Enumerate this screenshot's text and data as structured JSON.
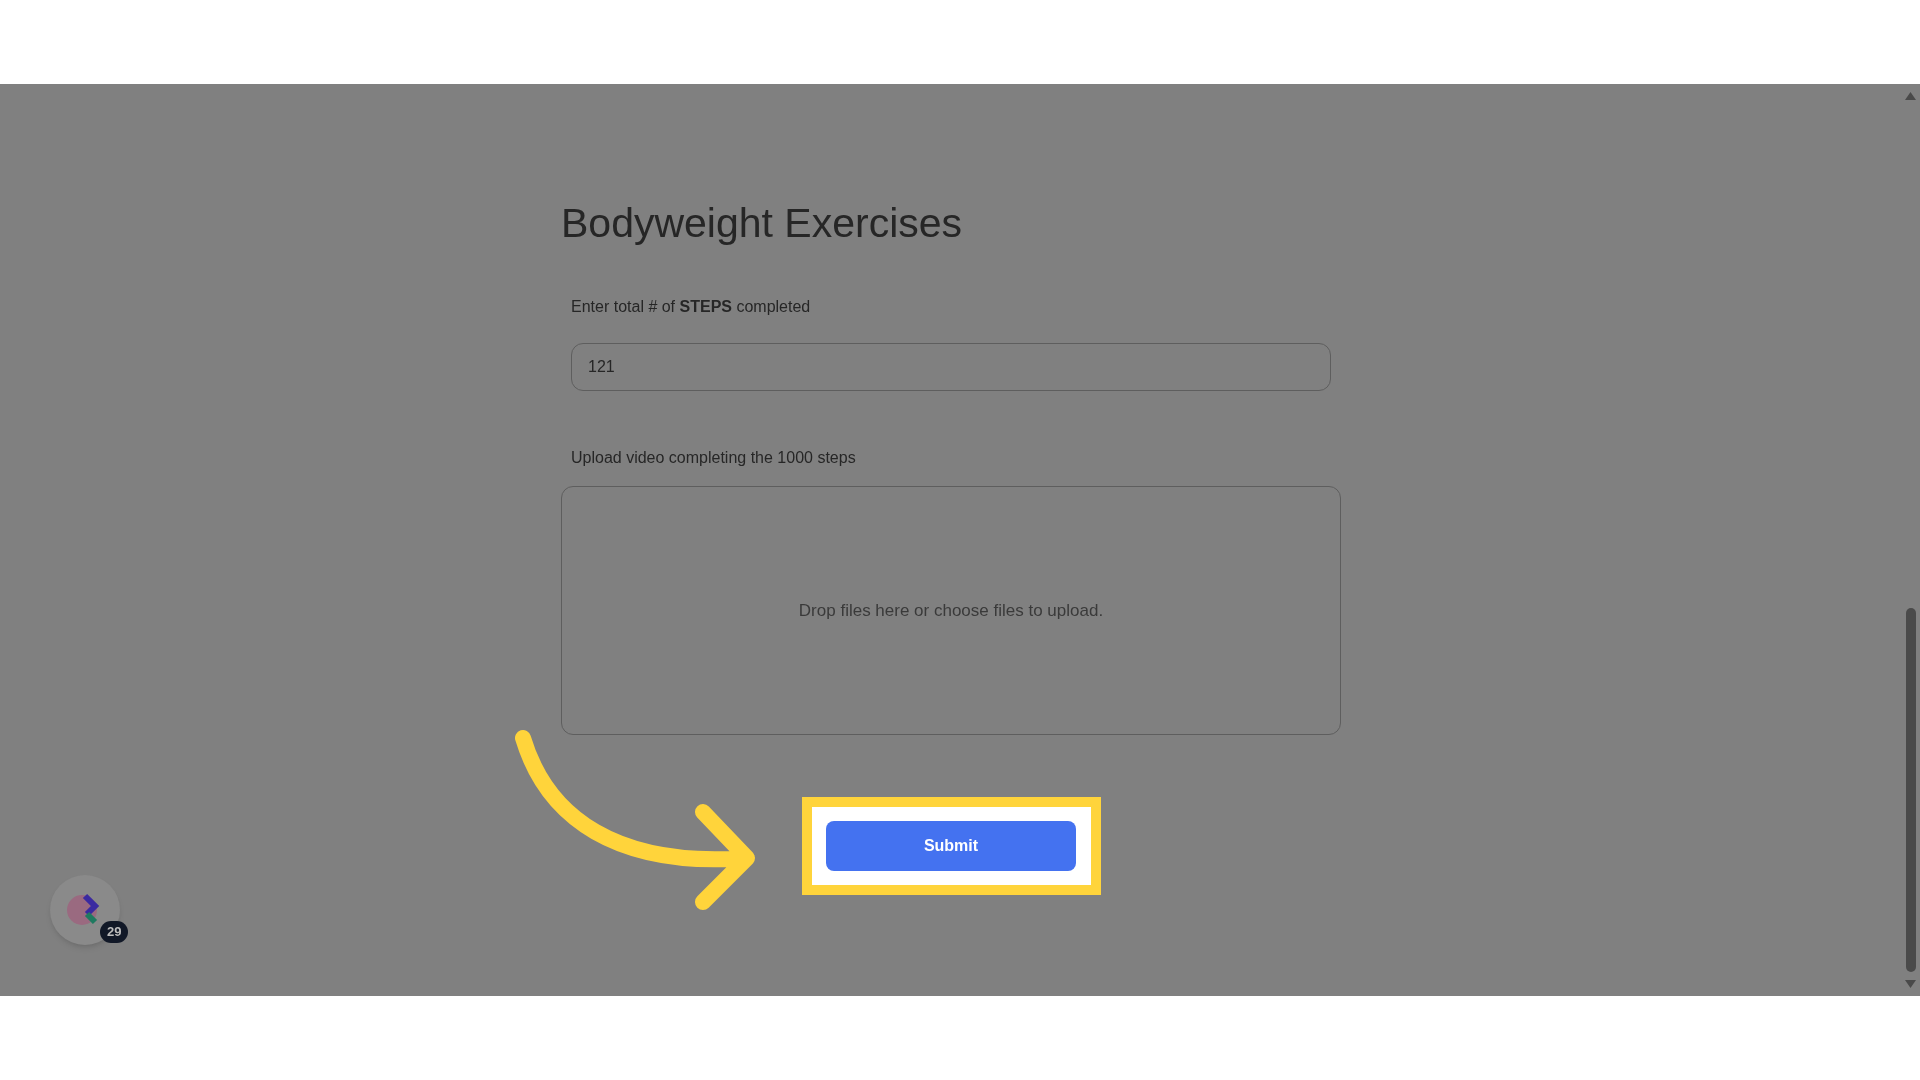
{
  "form": {
    "title": "Bodyweight Exercises",
    "steps_field": {
      "label": "Enter total # of **STEPS** completed",
      "value": "121"
    },
    "upload_field": {
      "label": "Upload video completing the 1000 steps",
      "dropzone_text": "Drop files here or choose files to upload."
    },
    "submit_button": "Submit"
  },
  "widget": {
    "badge": "29"
  }
}
